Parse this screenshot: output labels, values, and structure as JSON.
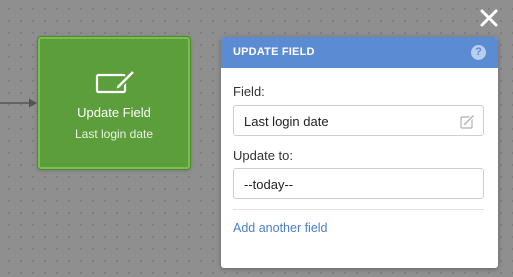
{
  "node": {
    "icon": "edit-field-icon",
    "title": "Update Field",
    "subtitle": "Last login date",
    "color": "#5c9e3b"
  },
  "panel": {
    "title": "UPDATE FIELD",
    "help_icon": "?",
    "header_color": "#5b8bd3",
    "field_label": "Field:",
    "field_value": "Last login date",
    "update_label": "Update to:",
    "update_value": "--today--",
    "add_link": "Add another field",
    "link_color": "#4a80c8"
  },
  "close_icon": "close-icon"
}
